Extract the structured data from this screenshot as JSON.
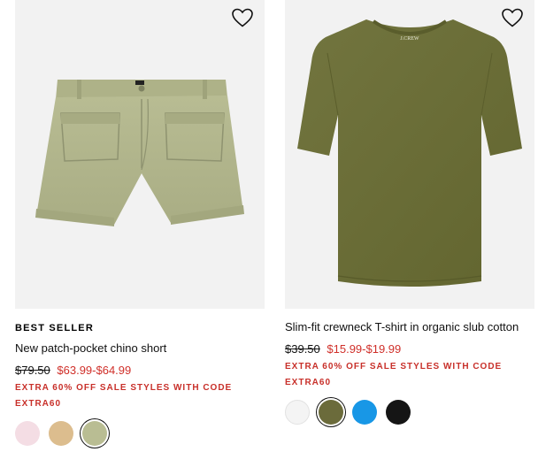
{
  "products": [
    {
      "badge": "BEST SELLER",
      "name": "New patch-pocket chino short",
      "original_price": "$79.50",
      "sale_price": "$63.99-$64.99",
      "promo": "EXTRA 60% OFF SALE STYLES WITH CODE EXTRA60",
      "swatches": [
        {
          "color": "#f4dde4",
          "selected": false
        },
        {
          "color": "#dcbd8e",
          "selected": false
        },
        {
          "color": "#b9bd93",
          "selected": true
        }
      ]
    },
    {
      "badge": "",
      "name": "Slim-fit crewneck T-shirt in organic slub cotton",
      "original_price": "$39.50",
      "sale_price": "$15.99-$19.99",
      "promo": "EXTRA 60% OFF SALE STYLES WITH CODE EXTRA60",
      "swatches": [
        {
          "color": "#f4f4f4",
          "selected": false
        },
        {
          "color": "#6b6b3b",
          "selected": true
        },
        {
          "color": "#1897e6",
          "selected": false
        },
        {
          "color": "#151515",
          "selected": false
        }
      ]
    }
  ],
  "icons": {
    "favorite": "heart-icon"
  },
  "colors": {
    "sale": "#d0302a",
    "short_fabric": "#b1b58c",
    "tee_fabric": "#6b6e3e"
  }
}
